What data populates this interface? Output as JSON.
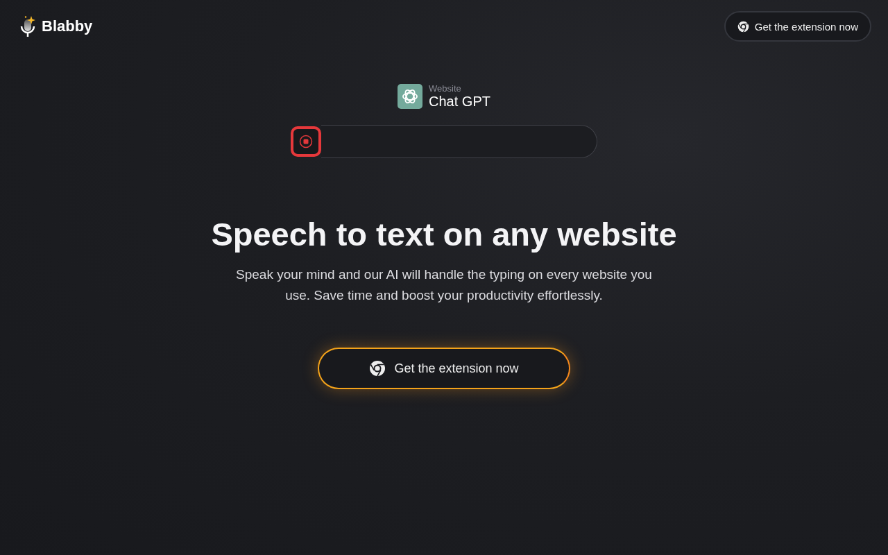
{
  "header": {
    "brand": "Blabby",
    "cta": "Get the extension now"
  },
  "demo": {
    "site_label": "Website",
    "site_name": "Chat GPT",
    "recorder": {
      "recording": true
    }
  },
  "hero": {
    "title": "Speech to text on any website",
    "subtitle": "Speak your mind and our AI will handle the typing on every website you use. Save time and boost your productivity effortlessly.",
    "cta": "Get the extension now"
  }
}
